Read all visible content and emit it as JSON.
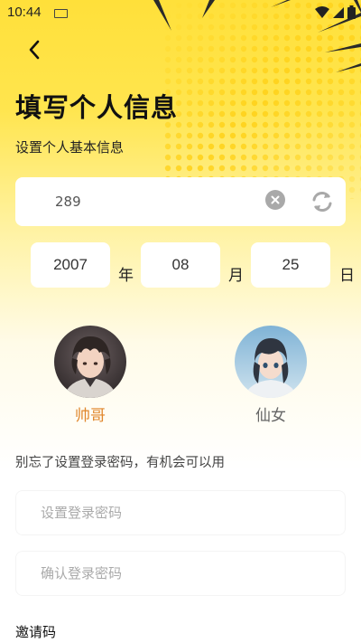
{
  "status_bar": {
    "time": "10:44"
  },
  "header": {
    "back_icon": "chevron-left-icon"
  },
  "page": {
    "title": "填写个人信息",
    "subtitle": "设置个人基本信息"
  },
  "name_field": {
    "value": "289"
  },
  "birthday": {
    "year": "2007",
    "year_unit": "年",
    "month": "08",
    "month_unit": "月",
    "day": "25",
    "day_unit": "日"
  },
  "gender": {
    "male_label": "帅哥",
    "female_label": "仙女",
    "selected": "male",
    "selected_color": "#e0862b"
  },
  "password": {
    "hint": "别忘了设置登录密码，有机会可以用",
    "set_placeholder": "设置登录密码",
    "confirm_placeholder": "确认登录密码"
  },
  "invite": {
    "label": "邀请码"
  },
  "colors": {
    "accent": "#ffe03a",
    "selected_text": "#e0862b"
  }
}
